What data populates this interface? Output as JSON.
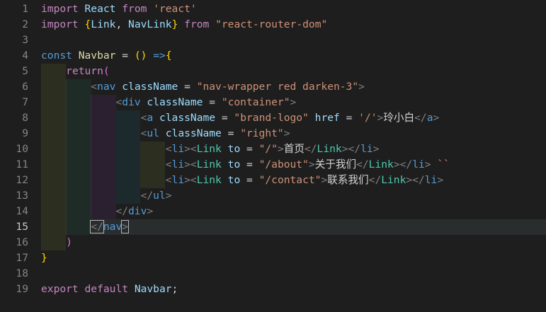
{
  "editor": {
    "active_line": 15,
    "line_numbers": [
      "1",
      "2",
      "3",
      "4",
      "5",
      "6",
      "7",
      "8",
      "9",
      "10",
      "11",
      "12",
      "13",
      "14",
      "15",
      "16",
      "17",
      "18",
      "19"
    ],
    "lines": [
      [
        {
          "t": "import",
          "c": "kw"
        },
        {
          "t": " "
        },
        {
          "t": "React",
          "c": "var"
        },
        {
          "t": " "
        },
        {
          "t": "from",
          "c": "kw"
        },
        {
          "t": " "
        },
        {
          "t": "'react'",
          "c": "str"
        }
      ],
      [
        {
          "t": "import",
          "c": "kw"
        },
        {
          "t": " "
        },
        {
          "t": "{",
          "c": "br-y"
        },
        {
          "t": "Link",
          "c": "var"
        },
        {
          "t": ", "
        },
        {
          "t": "NavLink",
          "c": "var"
        },
        {
          "t": "}",
          "c": "br-y"
        },
        {
          "t": " "
        },
        {
          "t": "from",
          "c": "kw"
        },
        {
          "t": " "
        },
        {
          "t": "\"react-router-dom\"",
          "c": "str"
        }
      ],
      [],
      [
        {
          "t": "const",
          "c": "decl"
        },
        {
          "t": " "
        },
        {
          "t": "Navbar",
          "c": "fn"
        },
        {
          "t": " "
        },
        {
          "t": "=",
          "c": "pun"
        },
        {
          "t": " "
        },
        {
          "t": "(",
          "c": "br-y"
        },
        {
          "t": ")",
          "c": "br-y"
        },
        {
          "t": " "
        },
        {
          "t": "=>",
          "c": "decl"
        },
        {
          "t": "{",
          "c": "br-y"
        }
      ],
      [
        {
          "t": "    "
        },
        {
          "t": "return",
          "c": "kw"
        },
        {
          "t": "(",
          "c": "br-p"
        }
      ],
      [
        {
          "t": "        "
        },
        {
          "t": "<",
          "c": "ang"
        },
        {
          "t": "nav",
          "c": "tag"
        },
        {
          "t": " "
        },
        {
          "t": "className",
          "c": "attr"
        },
        {
          "t": " = "
        },
        {
          "t": "\"nav-wrapper red darken-3\"",
          "c": "str"
        },
        {
          "t": ">",
          "c": "ang"
        }
      ],
      [
        {
          "t": "            "
        },
        {
          "t": "<",
          "c": "ang"
        },
        {
          "t": "div",
          "c": "tag"
        },
        {
          "t": " "
        },
        {
          "t": "className",
          "c": "attr"
        },
        {
          "t": " = "
        },
        {
          "t": "\"container\"",
          "c": "str"
        },
        {
          "t": ">",
          "c": "ang"
        }
      ],
      [
        {
          "t": "                "
        },
        {
          "t": "<",
          "c": "ang"
        },
        {
          "t": "a",
          "c": "tag"
        },
        {
          "t": " "
        },
        {
          "t": "className",
          "c": "attr"
        },
        {
          "t": " = "
        },
        {
          "t": "\"brand-logo\"",
          "c": "str"
        },
        {
          "t": " "
        },
        {
          "t": "href",
          "c": "attr"
        },
        {
          "t": " = "
        },
        {
          "t": "'/'",
          "c": "str"
        },
        {
          "t": ">",
          "c": "ang"
        },
        {
          "t": "玲小白",
          "c": "txt"
        },
        {
          "t": "</",
          "c": "ang"
        },
        {
          "t": "a",
          "c": "tag"
        },
        {
          "t": ">",
          "c": "ang"
        }
      ],
      [
        {
          "t": "                "
        },
        {
          "t": "<",
          "c": "ang"
        },
        {
          "t": "ul",
          "c": "tag"
        },
        {
          "t": " "
        },
        {
          "t": "className",
          "c": "attr"
        },
        {
          "t": " = "
        },
        {
          "t": "\"right\"",
          "c": "str"
        },
        {
          "t": ">",
          "c": "ang"
        }
      ],
      [
        {
          "t": "                    "
        },
        {
          "t": "<",
          "c": "ang"
        },
        {
          "t": "li",
          "c": "tag"
        },
        {
          "t": ">",
          "c": "ang"
        },
        {
          "t": "<",
          "c": "ang"
        },
        {
          "t": "Link",
          "c": "comp"
        },
        {
          "t": " "
        },
        {
          "t": "to",
          "c": "attr"
        },
        {
          "t": " = "
        },
        {
          "t": "\"/\"",
          "c": "str"
        },
        {
          "t": ">",
          "c": "ang"
        },
        {
          "t": "首页",
          "c": "txt"
        },
        {
          "t": "</",
          "c": "ang"
        },
        {
          "t": "Link",
          "c": "comp"
        },
        {
          "t": ">",
          "c": "ang"
        },
        {
          "t": "</",
          "c": "ang"
        },
        {
          "t": "li",
          "c": "tag"
        },
        {
          "t": ">",
          "c": "ang"
        }
      ],
      [
        {
          "t": "                    "
        },
        {
          "t": "<",
          "c": "ang"
        },
        {
          "t": "li",
          "c": "tag"
        },
        {
          "t": ">",
          "c": "ang"
        },
        {
          "t": "<",
          "c": "ang"
        },
        {
          "t": "Link",
          "c": "comp"
        },
        {
          "t": " "
        },
        {
          "t": "to",
          "c": "attr"
        },
        {
          "t": " = "
        },
        {
          "t": "\"/about\"",
          "c": "str"
        },
        {
          "t": ">",
          "c": "ang"
        },
        {
          "t": "关于我们",
          "c": "txt"
        },
        {
          "t": "</",
          "c": "ang"
        },
        {
          "t": "Link",
          "c": "comp"
        },
        {
          "t": ">",
          "c": "ang"
        },
        {
          "t": "</",
          "c": "ang"
        },
        {
          "t": "li",
          "c": "tag"
        },
        {
          "t": ">",
          "c": "ang"
        },
        {
          "t": " ``",
          "c": "str"
        }
      ],
      [
        {
          "t": "                    "
        },
        {
          "t": "<",
          "c": "ang"
        },
        {
          "t": "li",
          "c": "tag"
        },
        {
          "t": ">",
          "c": "ang"
        },
        {
          "t": "<",
          "c": "ang"
        },
        {
          "t": "Link",
          "c": "comp"
        },
        {
          "t": " "
        },
        {
          "t": "to",
          "c": "attr"
        },
        {
          "t": " = "
        },
        {
          "t": "\"/contact\"",
          "c": "str"
        },
        {
          "t": ">",
          "c": "ang"
        },
        {
          "t": "联系我们",
          "c": "txt"
        },
        {
          "t": "</",
          "c": "ang"
        },
        {
          "t": "Link",
          "c": "comp"
        },
        {
          "t": ">",
          "c": "ang"
        },
        {
          "t": "</",
          "c": "ang"
        },
        {
          "t": "li",
          "c": "tag"
        },
        {
          "t": ">",
          "c": "ang"
        }
      ],
      [
        {
          "t": "                "
        },
        {
          "t": "</",
          "c": "ang"
        },
        {
          "t": "ul",
          "c": "tag"
        },
        {
          "t": ">",
          "c": "ang"
        }
      ],
      [
        {
          "t": "            "
        },
        {
          "t": "</",
          "c": "ang"
        },
        {
          "t": "div",
          "c": "tag"
        },
        {
          "t": ">",
          "c": "ang"
        }
      ],
      [
        {
          "t": "        "
        },
        {
          "t": "</",
          "c": "ang"
        },
        {
          "t": "nav",
          "c": "tag"
        },
        {
          "t": ">",
          "c": "ang"
        }
      ],
      [
        {
          "t": "    "
        },
        {
          "t": ")",
          "c": "br-p"
        }
      ],
      [
        {
          "t": "}",
          "c": "br-y"
        }
      ],
      [],
      [
        {
          "t": "export",
          "c": "kw"
        },
        {
          "t": " "
        },
        {
          "t": "default",
          "c": "kw"
        },
        {
          "t": " "
        },
        {
          "t": "Navbar",
          "c": "var"
        },
        {
          "t": ";",
          "c": "pun"
        }
      ]
    ]
  }
}
